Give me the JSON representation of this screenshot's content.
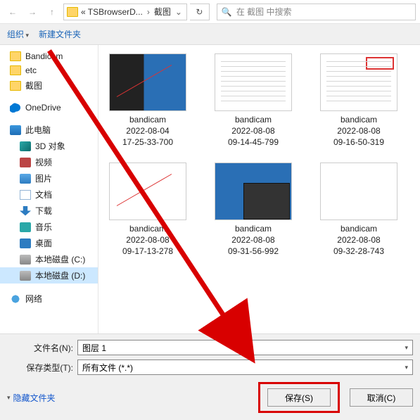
{
  "address": {
    "crumb1": "« TSBrowserD...",
    "crumb2": "截图",
    "refresh_title": "刷新"
  },
  "search": {
    "placeholder": "在 截图 中搜索"
  },
  "toolbar": {
    "organize": "组织",
    "new_folder": "新建文件夹"
  },
  "sidebar": {
    "quick": [
      {
        "label": "Bandicam",
        "ico": "folder"
      },
      {
        "label": "etc",
        "ico": "folder"
      },
      {
        "label": "截图",
        "ico": "folder"
      }
    ],
    "onedrive": "OneDrive",
    "this_pc": "此电脑",
    "pc_items": [
      {
        "label": "3D 对象",
        "ico": "obj3d"
      },
      {
        "label": "视频",
        "ico": "video"
      },
      {
        "label": "图片",
        "ico": "pics"
      },
      {
        "label": "文档",
        "ico": "docs"
      },
      {
        "label": "下载",
        "ico": "dl"
      },
      {
        "label": "音乐",
        "ico": "music"
      },
      {
        "label": "桌面",
        "ico": "desk"
      },
      {
        "label": "本地磁盘 (C:)",
        "ico": "disk"
      },
      {
        "label": "本地磁盘 (D:)",
        "ico": "disk",
        "sel": true
      }
    ],
    "network": "网络"
  },
  "files": [
    {
      "line1": "bandicam",
      "line2": "2022-08-04",
      "line3": "17-25-33-700",
      "thumb": "dark red-line"
    },
    {
      "line1": "bandicam",
      "line2": "2022-08-08",
      "line3": "09-14-45-799",
      "thumb": "doc"
    },
    {
      "line1": "bandicam",
      "line2": "2022-08-08",
      "line3": "09-16-50-319",
      "thumb": "doc red-box"
    },
    {
      "line1": "bandicam",
      "line2": "2022-08-08",
      "line3": "09-17-13-278",
      "thumb": "white red-line"
    },
    {
      "line1": "bandicam",
      "line2": "2022-08-08",
      "line3": "09-31-56-992",
      "thumb": "win"
    },
    {
      "line1": "bandicam",
      "line2": "2022-08-08",
      "line3": "09-32-28-743",
      "thumb": "white"
    }
  ],
  "bottom": {
    "filename_label": "文件名(N):",
    "filename_value": "图层 1",
    "filetype_label": "保存类型(T):",
    "filetype_value": "所有文件 (*.*)",
    "hide_folders": "隐藏文件夹",
    "save": "保存(S)",
    "cancel": "取消(C)"
  }
}
